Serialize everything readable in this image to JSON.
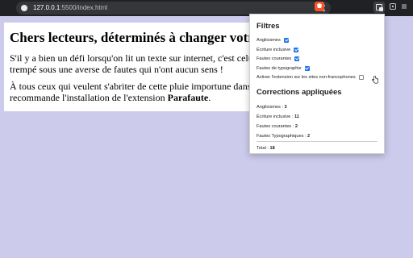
{
  "browser": {
    "url_host": "127.0.0.1",
    "url_path": ":5500/index.html"
  },
  "page": {
    "heading": "Chers lecteurs, déterminés à changer votre",
    "p1_line1": "S'il y a bien un défi lorsqu'on lit un texte sur internet, c'est celui de",
    "p1_line2": "trempé sous une averse de fautes qui n'ont aucun sens !",
    "p2_line1": "À tous ceux qui veulent s'abriter de cette pluie importune dans leur",
    "p2_line2_before": "recommande l'installation de l'extension ",
    "p2_line2_bold": "Parafaute",
    "p2_line2_after": "."
  },
  "popup": {
    "filters_title": "Filtres",
    "filters": [
      {
        "label": "Anglicismes",
        "checked": true
      },
      {
        "label": "Écriture inclusive",
        "checked": true
      },
      {
        "label": "Fautes courantes",
        "checked": true
      },
      {
        "label": "Fautes de typographie",
        "checked": true
      },
      {
        "label": "Activer l'extension sur les sites non-francophones",
        "checked": false
      }
    ],
    "corrections_title": "Corrections appliquées",
    "stats": [
      {
        "label": "Anglicismes : ",
        "value": "3"
      },
      {
        "label": "Écriture inclusive : ",
        "value": "11"
      },
      {
        "label": "Fautes courantes : ",
        "value": "2"
      },
      {
        "label": "Fautes Typographiques : ",
        "value": "2"
      }
    ],
    "total_label": "Total : ",
    "total_value": "18"
  },
  "icons": {
    "site": "info-icon",
    "share": "share-icon",
    "brave": "brave-shield-icon",
    "extension": "parafaute-extension-icon",
    "puzzle": "puzzle-icon",
    "menu": "menu-icon"
  },
  "colors": {
    "page_background": "#cdcbec",
    "checkbox_accent": "#1a73e8",
    "toolbar": "#202124"
  }
}
